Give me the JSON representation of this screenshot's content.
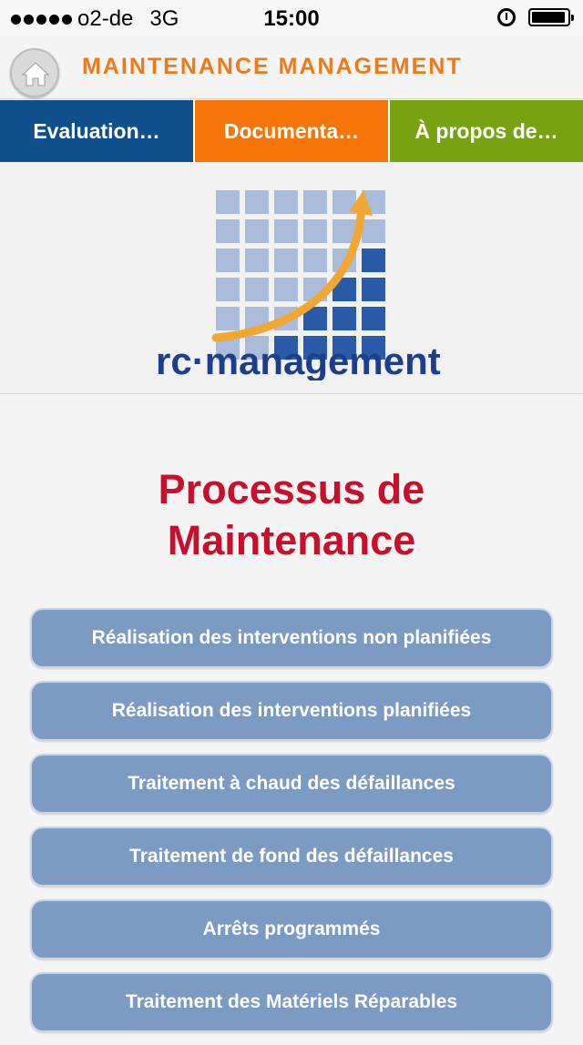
{
  "status_bar": {
    "carrier": "o2-de",
    "network": "3G",
    "time": "15:00",
    "icons": [
      "signal-dots-icon",
      "alarm-icon",
      "battery-icon"
    ]
  },
  "header": {
    "title": "MAINTENANCE MANAGEMENT",
    "home_icon": "home-icon",
    "accent_color": "#ee7b1a"
  },
  "tabs": [
    {
      "label": "Evaluation…",
      "color": "#0f4f8c"
    },
    {
      "label": "Documenta…",
      "color": "#f57508"
    },
    {
      "label": "À propos de…",
      "color": "#77a312"
    }
  ],
  "logo": {
    "brand_text": "rc·management"
  },
  "main": {
    "heading_line1": "Processus de",
    "heading_line2": "Maintenance",
    "heading_color": "#c8102e",
    "buttons": [
      "Réalisation des interventions non planifiées",
      "Réalisation des interventions planifiées",
      "Traitement à chaud des défaillances",
      "Traitement de fond des défaillances",
      "Arrêts programmés",
      "Traitement des Matériels Réparables"
    ],
    "button_color": "#7b9bc3"
  }
}
